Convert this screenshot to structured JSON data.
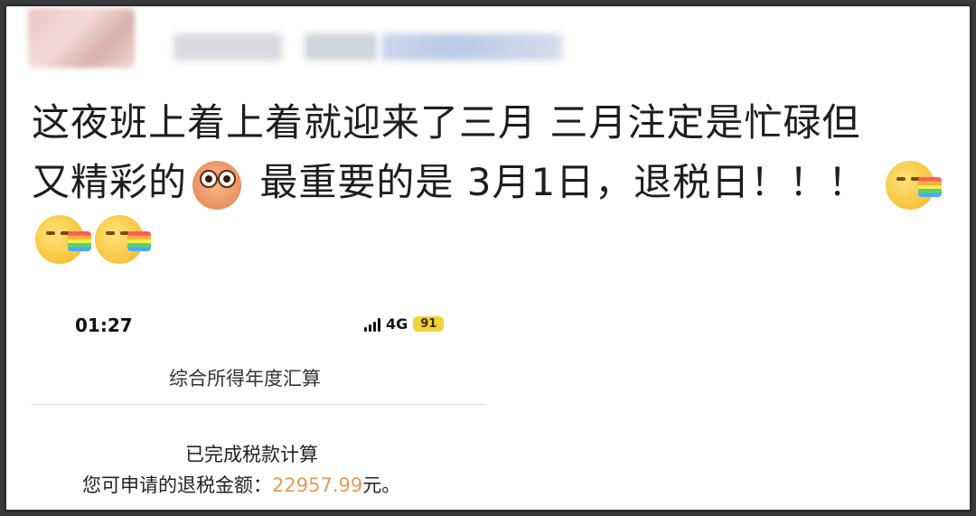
{
  "post": {
    "line1": "这夜班上着上着就迎来了三月 三月注定是忙碌但",
    "line2_a": "又精彩的",
    "line2_b": " 最重要的是 3月1日，退税日！！！",
    "emojis": [
      "pig-emoji",
      "rainbow-emoji",
      "rainbow-emoji",
      "rainbow-emoji"
    ]
  },
  "phone": {
    "time": "01:27",
    "network": "4G",
    "battery": "91",
    "title": "综合所得年度汇算",
    "status_line": "已完成税款计算",
    "refund_label": "您可申请的退税金额：",
    "refund_amount": "22957.99",
    "refund_unit": "元。",
    "colors": {
      "amount": "#e39b58",
      "battery": "#f2d23c"
    }
  }
}
